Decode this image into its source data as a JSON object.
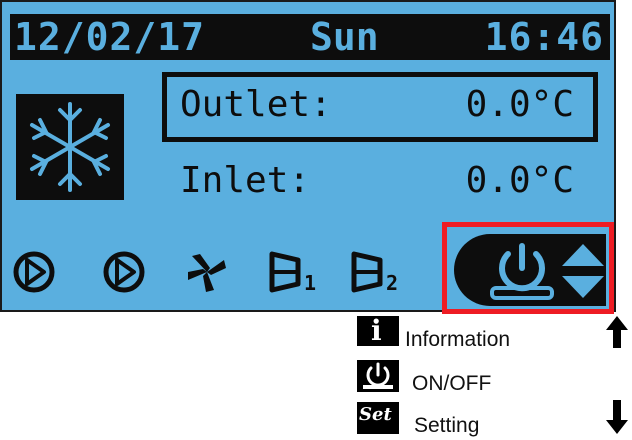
{
  "status_bar": {
    "date": "12/02/17",
    "day": "Sun",
    "time": "16:46"
  },
  "readings": {
    "outlet_label": "Outlet:",
    "outlet_value": "0.0°C",
    "inlet_label": "Inlet:",
    "inlet_value": "0.0°C"
  },
  "status_icons": [
    "pump-1-icon",
    "pump-2-icon",
    "fan-icon",
    "compressor-1-icon",
    "compressor-2-icon"
  ],
  "compressor_subscripts": [
    "1",
    "2"
  ],
  "control_icons": [
    "power-icon",
    "up-down-arrows-icon"
  ],
  "legend": {
    "info_glyph": "i",
    "info_label": "Information",
    "onoff_label": "ON/OFF",
    "set_glyph": "Set",
    "setting_label": "Setting"
  },
  "colors": {
    "lcd_background": "#5aafdf",
    "lcd_foreground": "#0d0d0d",
    "highlight": "#ee1c24"
  }
}
